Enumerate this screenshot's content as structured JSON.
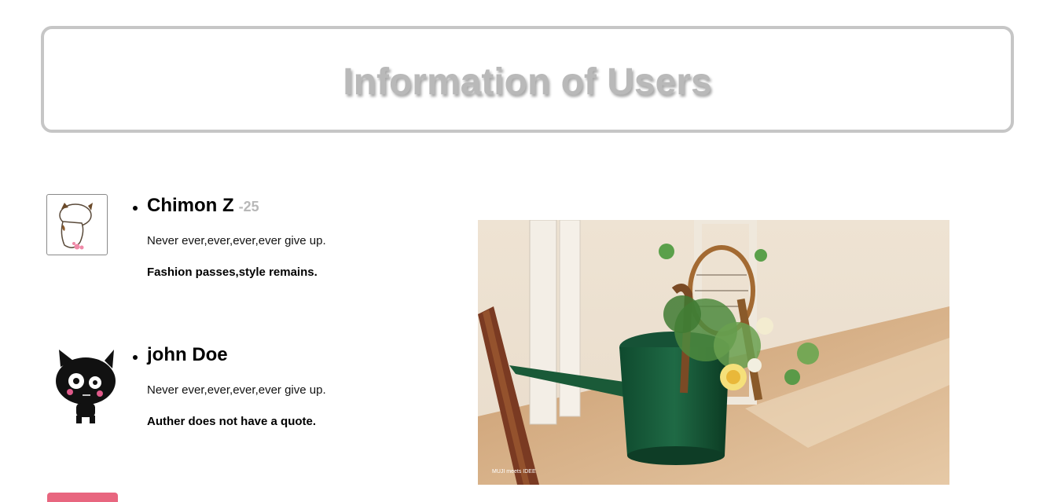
{
  "header": {
    "title": "Information of Users"
  },
  "users": [
    {
      "name": "Chimon Z",
      "age": "-25",
      "motto": "Never ever,ever,ever,ever give up.",
      "quote": "Fashion passes,style remains."
    },
    {
      "name": "john Doe",
      "age": "",
      "motto": "Never ever,ever,ever,ever give up.",
      "quote": "Auther does not have a quote."
    }
  ],
  "photo": {
    "watermark": "MUJI meets IDEE"
  },
  "colors": {
    "title": "#b9b9b9",
    "border": "#c6c6c6",
    "age": "#b8b8b8"
  }
}
